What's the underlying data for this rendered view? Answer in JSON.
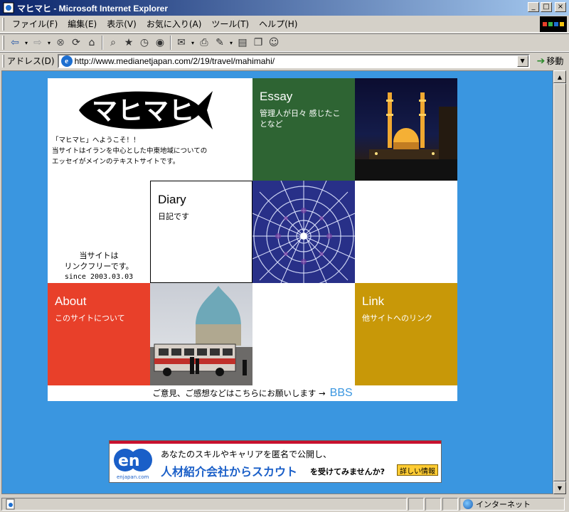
{
  "window": {
    "title": "マヒマヒ - Microsoft Internet Explorer",
    "controls": {
      "minimize": "_",
      "maximize": "□",
      "close": "×"
    }
  },
  "menu": [
    "ファイル(F)",
    "編集(E)",
    "表示(V)",
    "お気に入り(A)",
    "ツール(T)",
    "ヘルプ(H)"
  ],
  "toolbar": {
    "icons": [
      "back-icon",
      "forward-icon",
      "stop-icon",
      "refresh-icon",
      "home-icon",
      "search-icon",
      "favorites-icon",
      "history-icon",
      "mail-icon",
      "print-icon",
      "edit-icon",
      "discuss-icon",
      "messenger-icon"
    ]
  },
  "address": {
    "label": "アドレス(D)",
    "url": "http://www.medianetjapan.com/2/19/travel/mahimahi/",
    "go_label": "移動"
  },
  "site": {
    "logo_text": "マヒマヒ",
    "intro_lines": [
      "「マヒマヒ」へようこそ！！",
      "当サイトはイランを中心とした中東地域についての",
      "エッセイがメインのテキストサイトです。"
    ],
    "essay": {
      "label": "Essay",
      "sub": "管理人が日々 感じたことなど"
    },
    "diary": {
      "label": "Diary",
      "sub": "日記です"
    },
    "linkfree_lines": [
      "当サイトは",
      "リンクフリーです。",
      "since 2003.03.03"
    ],
    "about": {
      "label": "About",
      "sub": "このサイトについて"
    },
    "link": {
      "label": "Link",
      "sub": "他サイトへのリンク"
    },
    "feedback": "ご意見、ご感想などはこちらにお願いします →",
    "bbs": "BBS"
  },
  "banner": {
    "logo": "en",
    "logo_sub": "enjapan.com",
    "line1": "あなたのスキルやキャリアを匿名で公開し、",
    "line2": "人材紹介会社からスカウト",
    "line2b": "を受けてみませんか?",
    "detail": "詳しい情報"
  },
  "status": {
    "zone": "インターネット"
  },
  "colors": {
    "page_bg": "#3a96e0",
    "essay": "#2e6433",
    "about": "#e8402a",
    "link": "#c89808",
    "bbs": "#3a96e0"
  }
}
